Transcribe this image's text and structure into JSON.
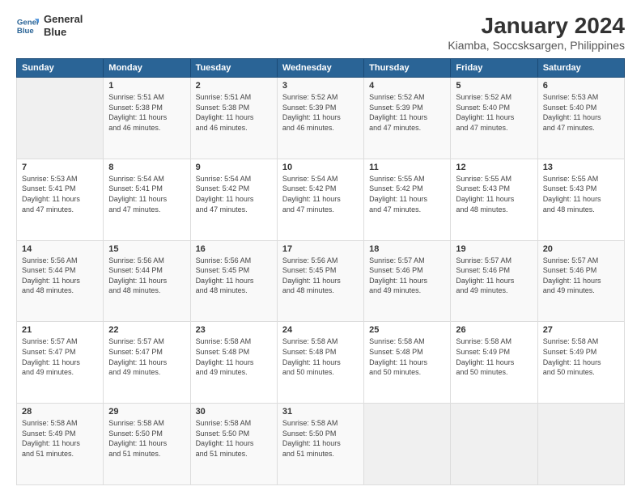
{
  "logo": {
    "line1": "General",
    "line2": "Blue"
  },
  "title": "January 2024",
  "subtitle": "Kiamba, Soccsksargen, Philippines",
  "days_of_week": [
    "Sunday",
    "Monday",
    "Tuesday",
    "Wednesday",
    "Thursday",
    "Friday",
    "Saturday"
  ],
  "weeks": [
    [
      {
        "day": "",
        "content": ""
      },
      {
        "day": "1",
        "content": "Sunrise: 5:51 AM\nSunset: 5:38 PM\nDaylight: 11 hours\nand 46 minutes."
      },
      {
        "day": "2",
        "content": "Sunrise: 5:51 AM\nSunset: 5:38 PM\nDaylight: 11 hours\nand 46 minutes."
      },
      {
        "day": "3",
        "content": "Sunrise: 5:52 AM\nSunset: 5:39 PM\nDaylight: 11 hours\nand 46 minutes."
      },
      {
        "day": "4",
        "content": "Sunrise: 5:52 AM\nSunset: 5:39 PM\nDaylight: 11 hours\nand 47 minutes."
      },
      {
        "day": "5",
        "content": "Sunrise: 5:52 AM\nSunset: 5:40 PM\nDaylight: 11 hours\nand 47 minutes."
      },
      {
        "day": "6",
        "content": "Sunrise: 5:53 AM\nSunset: 5:40 PM\nDaylight: 11 hours\nand 47 minutes."
      }
    ],
    [
      {
        "day": "7",
        "content": "Sunrise: 5:53 AM\nSunset: 5:41 PM\nDaylight: 11 hours\nand 47 minutes."
      },
      {
        "day": "8",
        "content": "Sunrise: 5:54 AM\nSunset: 5:41 PM\nDaylight: 11 hours\nand 47 minutes."
      },
      {
        "day": "9",
        "content": "Sunrise: 5:54 AM\nSunset: 5:42 PM\nDaylight: 11 hours\nand 47 minutes."
      },
      {
        "day": "10",
        "content": "Sunrise: 5:54 AM\nSunset: 5:42 PM\nDaylight: 11 hours\nand 47 minutes."
      },
      {
        "day": "11",
        "content": "Sunrise: 5:55 AM\nSunset: 5:42 PM\nDaylight: 11 hours\nand 47 minutes."
      },
      {
        "day": "12",
        "content": "Sunrise: 5:55 AM\nSunset: 5:43 PM\nDaylight: 11 hours\nand 48 minutes."
      },
      {
        "day": "13",
        "content": "Sunrise: 5:55 AM\nSunset: 5:43 PM\nDaylight: 11 hours\nand 48 minutes."
      }
    ],
    [
      {
        "day": "14",
        "content": "Sunrise: 5:56 AM\nSunset: 5:44 PM\nDaylight: 11 hours\nand 48 minutes."
      },
      {
        "day": "15",
        "content": "Sunrise: 5:56 AM\nSunset: 5:44 PM\nDaylight: 11 hours\nand 48 minutes."
      },
      {
        "day": "16",
        "content": "Sunrise: 5:56 AM\nSunset: 5:45 PM\nDaylight: 11 hours\nand 48 minutes."
      },
      {
        "day": "17",
        "content": "Sunrise: 5:56 AM\nSunset: 5:45 PM\nDaylight: 11 hours\nand 48 minutes."
      },
      {
        "day": "18",
        "content": "Sunrise: 5:57 AM\nSunset: 5:46 PM\nDaylight: 11 hours\nand 49 minutes."
      },
      {
        "day": "19",
        "content": "Sunrise: 5:57 AM\nSunset: 5:46 PM\nDaylight: 11 hours\nand 49 minutes."
      },
      {
        "day": "20",
        "content": "Sunrise: 5:57 AM\nSunset: 5:46 PM\nDaylight: 11 hours\nand 49 minutes."
      }
    ],
    [
      {
        "day": "21",
        "content": "Sunrise: 5:57 AM\nSunset: 5:47 PM\nDaylight: 11 hours\nand 49 minutes."
      },
      {
        "day": "22",
        "content": "Sunrise: 5:57 AM\nSunset: 5:47 PM\nDaylight: 11 hours\nand 49 minutes."
      },
      {
        "day": "23",
        "content": "Sunrise: 5:58 AM\nSunset: 5:48 PM\nDaylight: 11 hours\nand 49 minutes."
      },
      {
        "day": "24",
        "content": "Sunrise: 5:58 AM\nSunset: 5:48 PM\nDaylight: 11 hours\nand 50 minutes."
      },
      {
        "day": "25",
        "content": "Sunrise: 5:58 AM\nSunset: 5:48 PM\nDaylight: 11 hours\nand 50 minutes."
      },
      {
        "day": "26",
        "content": "Sunrise: 5:58 AM\nSunset: 5:49 PM\nDaylight: 11 hours\nand 50 minutes."
      },
      {
        "day": "27",
        "content": "Sunrise: 5:58 AM\nSunset: 5:49 PM\nDaylight: 11 hours\nand 50 minutes."
      }
    ],
    [
      {
        "day": "28",
        "content": "Sunrise: 5:58 AM\nSunset: 5:49 PM\nDaylight: 11 hours\nand 51 minutes."
      },
      {
        "day": "29",
        "content": "Sunrise: 5:58 AM\nSunset: 5:50 PM\nDaylight: 11 hours\nand 51 minutes."
      },
      {
        "day": "30",
        "content": "Sunrise: 5:58 AM\nSunset: 5:50 PM\nDaylight: 11 hours\nand 51 minutes."
      },
      {
        "day": "31",
        "content": "Sunrise: 5:58 AM\nSunset: 5:50 PM\nDaylight: 11 hours\nand 51 minutes."
      },
      {
        "day": "",
        "content": ""
      },
      {
        "day": "",
        "content": ""
      },
      {
        "day": "",
        "content": ""
      }
    ]
  ]
}
